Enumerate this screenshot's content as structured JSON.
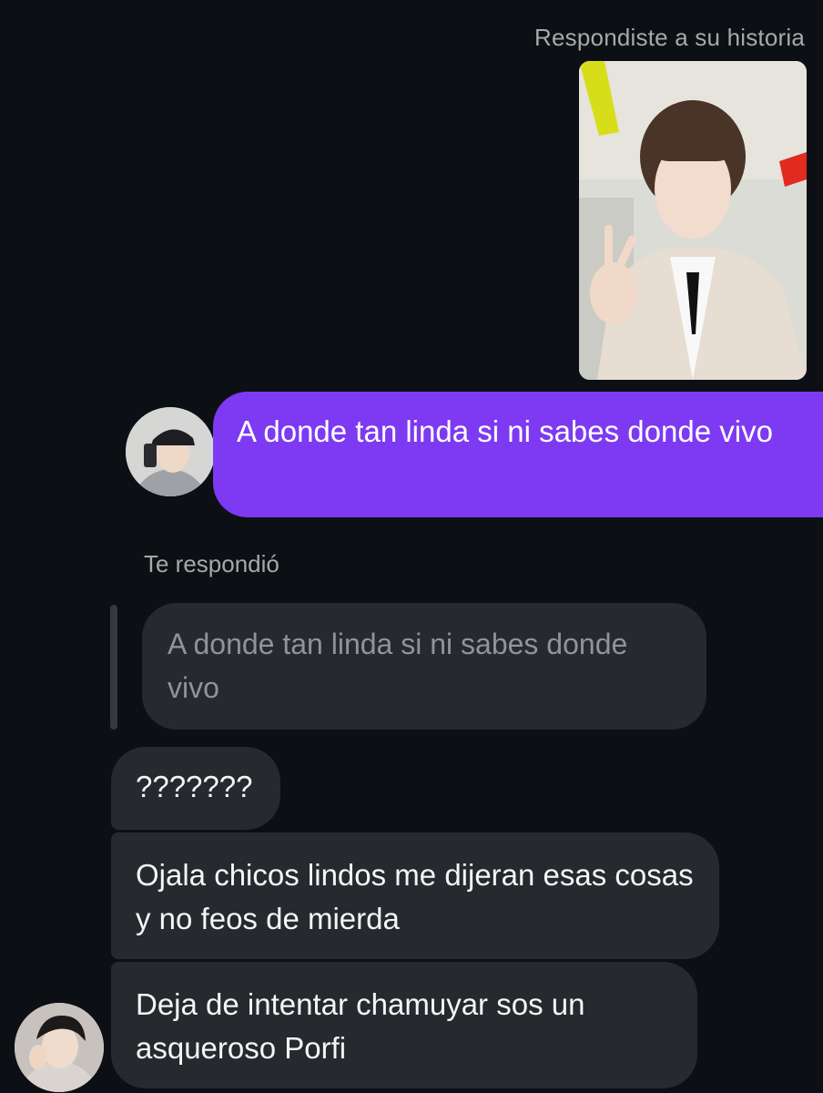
{
  "thread": {
    "story_reply_label": "Respondiste a su historia",
    "sent_message": "A donde tan linda si ni sabes donde vivo",
    "replied_label": "Te respondió",
    "quoted_message": "A donde tan linda si ni sabes donde vivo",
    "received_messages": [
      "???????",
      "Ojala chicos lindos me dijeran esas cosas y no feos de mierda",
      "Deja de intentar chamuyar sos un asqueroso Porfi"
    ]
  },
  "colors": {
    "background": "#0c1014",
    "sent_bubble": "#7d3af2",
    "received_bubble": "#26292e",
    "meta_text": "#a8a8a8",
    "quoted_text": "#8f949a"
  },
  "icons": {
    "story_thumbnail": "story-photo",
    "my_avatar": "user-avatar",
    "their_avatar": "contact-avatar"
  }
}
